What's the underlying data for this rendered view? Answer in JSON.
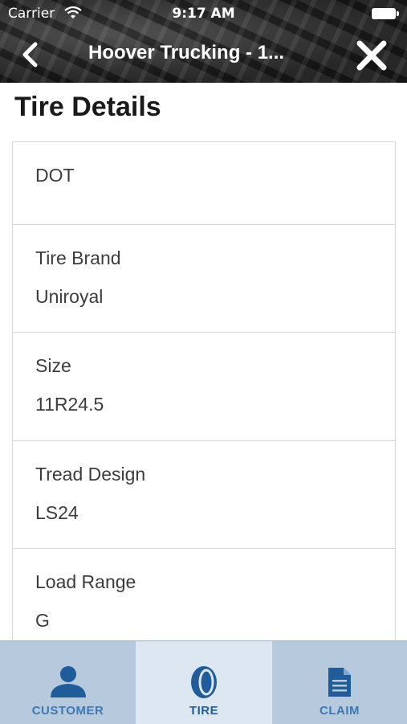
{
  "status_bar": {
    "carrier": "Carrier",
    "time": "9:17 AM"
  },
  "nav": {
    "title": "Hoover Trucking - 1..."
  },
  "page": {
    "title": "Tire Details"
  },
  "details": [
    {
      "label": "DOT",
      "value": ""
    },
    {
      "label": "Tire Brand",
      "value": "Uniroyal"
    },
    {
      "label": "Size",
      "value": "11R24.5"
    },
    {
      "label": "Tread Design",
      "value": "LS24"
    },
    {
      "label": "Load Range",
      "value": "G"
    }
  ],
  "tabs": [
    {
      "label": "CUSTOMER",
      "icon": "person-icon",
      "active": false
    },
    {
      "label": "TIRE",
      "icon": "tire-icon",
      "active": true
    },
    {
      "label": "CLAIM",
      "icon": "document-icon",
      "active": false
    }
  ],
  "colors": {
    "tab_bar_bg": "#b6c9dd",
    "tab_active_bg": "#dce7f2",
    "tab_icon": "#1f5c99",
    "tab_label": "#3c78b4"
  }
}
